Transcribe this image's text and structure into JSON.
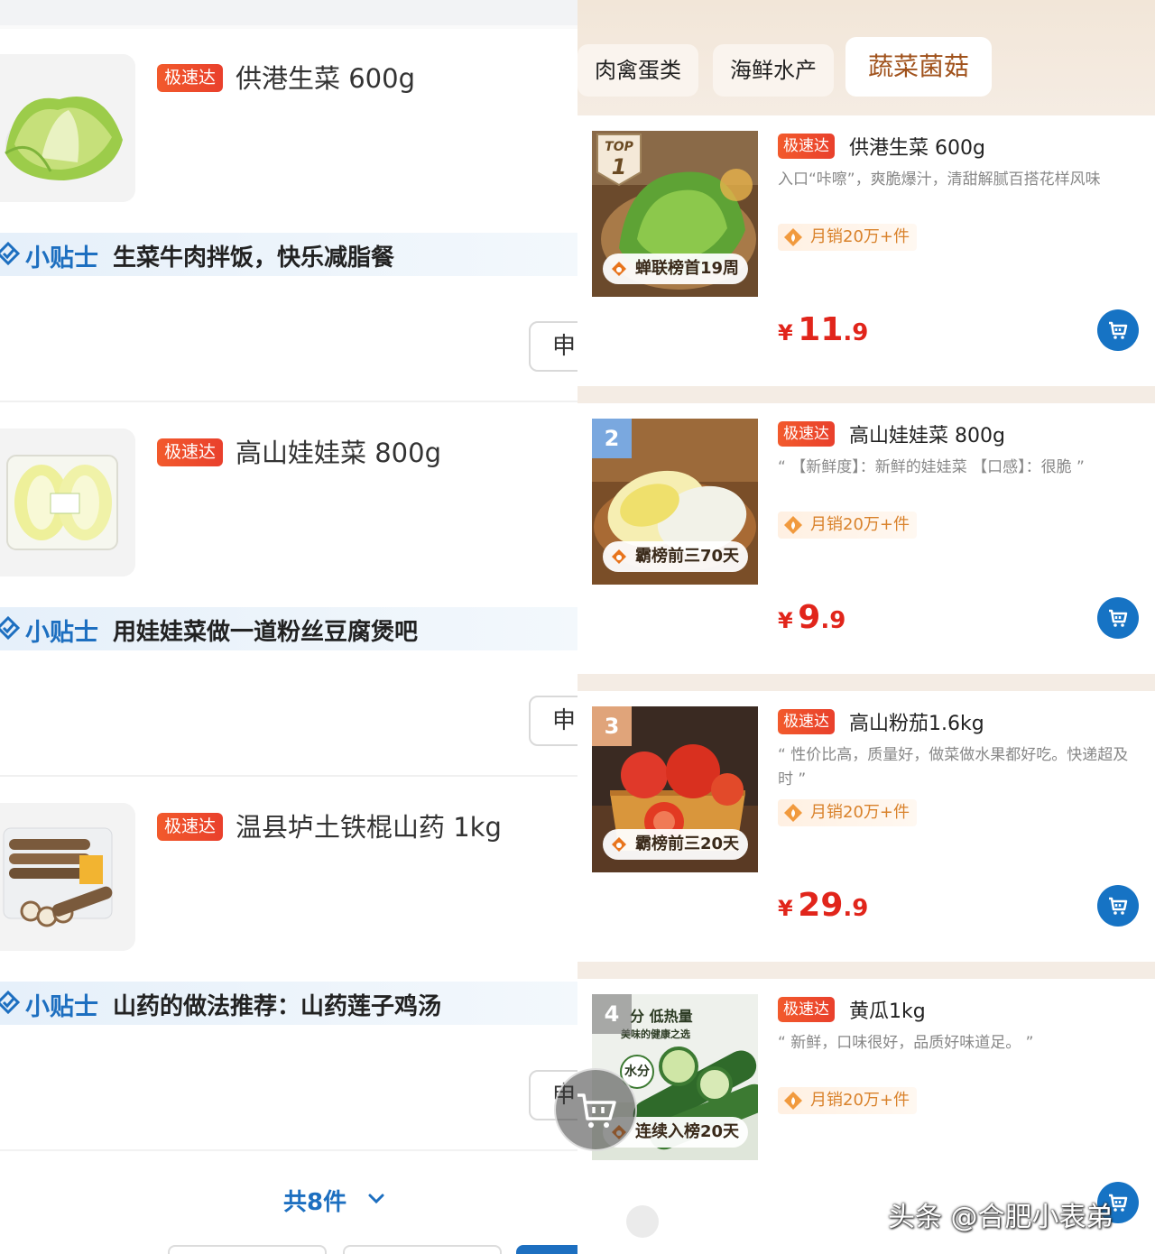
{
  "left": {
    "items": [
      {
        "badge": "极速达",
        "title": "供港生菜 600g",
        "tip_label": "小贴士",
        "tip": "生菜牛肉拌饭，快乐减脂餐",
        "button": "申"
      },
      {
        "badge": "极速达",
        "title": "高山娃娃菜 800g",
        "tip_label": "小贴士",
        "tip": "用娃娃菜做一道粉丝豆腐煲吧",
        "button": "申"
      },
      {
        "badge": "极速达",
        "title": "温县垆土铁棍山药 1kg",
        "tip_label": "小贴士",
        "tip": "山药的做法推荐：山药莲子鸡汤",
        "button": "申"
      }
    ],
    "footer": {
      "total_label": "共8件"
    }
  },
  "right": {
    "tabs": [
      {
        "label": "肉禽蛋类",
        "active": false
      },
      {
        "label": "海鲜水产",
        "active": false
      },
      {
        "label": "蔬菜菌菇",
        "active": true
      }
    ],
    "products": [
      {
        "rank": "TOP 1",
        "pill": "蝉联榜首19周",
        "badge": "极速达",
        "title": "供港生菜 600g",
        "desc": "入口“咔嚓”，爽脆爆汁，清甜解腻百搭花样风味",
        "sales": "月销20万+件",
        "price_currency": "¥",
        "price_int": "11",
        "price_dec": ".9"
      },
      {
        "rank": "2",
        "pill": "霸榜前三70天",
        "badge": "极速达",
        "title": "高山娃娃菜 800g",
        "desc": "“ 【新鲜度】：新鲜的娃娃菜 【口感】：很脆 ”",
        "sales": "月销20万+件",
        "price_currency": "¥",
        "price_int": "9",
        "price_dec": ".9"
      },
      {
        "rank": "3",
        "pill": "霸榜前三20天",
        "badge": "极速达",
        "title": "高山粉茄1.6kg",
        "desc": "“ 性价比高，质量好，做菜做水果都好吃。快递超及时 ”",
        "sales": "月销20万+件",
        "price_currency": "¥",
        "price_int": "29",
        "price_dec": ".9"
      },
      {
        "rank": "4",
        "pill": "连续入榜20天",
        "badge": "极速达",
        "title": "黄瓜1kg",
        "desc": "“ 新鲜，口味很好，品质好味道足。 ”",
        "sales": "月销20万+件",
        "price_currency": "¥",
        "price_int": "",
        "price_dec": ""
      }
    ],
    "cucumber_img_text": {
      "line1": "分 低热量",
      "line2": "美味的健康之选",
      "line3": "水分"
    }
  },
  "watermark": "头条 @合肥小表弟",
  "colors": {
    "accent_blue": "#1d6fc0",
    "price_red": "#e1251b",
    "badge_red": "#ea4a2c",
    "tab_active": "#a0521c"
  }
}
